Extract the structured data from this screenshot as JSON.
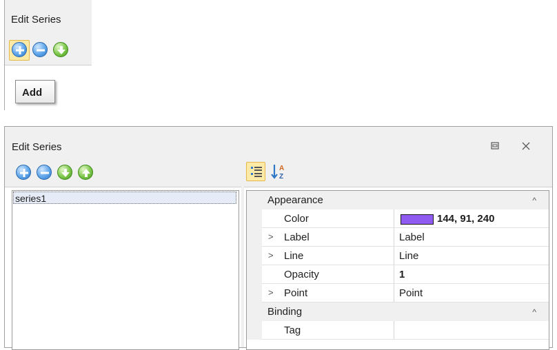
{
  "top_crop": {
    "title": "Edit Series",
    "tooltip": "Add"
  },
  "dialog": {
    "title": "Edit Series",
    "series": [
      "series1"
    ],
    "grid": {
      "categories": [
        {
          "name": "Appearance"
        },
        {
          "name": "Binding"
        }
      ],
      "appearance": {
        "color": {
          "label": "Color",
          "value": "144, 91, 240",
          "swatch": "#905bf0"
        },
        "label": {
          "label": "Label",
          "value": "Label"
        },
        "line": {
          "label": "Line",
          "value": "Line"
        },
        "opacity": {
          "label": "Opacity",
          "value": "1"
        },
        "point": {
          "label": "Point",
          "value": "Point"
        }
      },
      "binding": {
        "tag": {
          "label": "Tag",
          "value": ""
        }
      }
    }
  },
  "icons": {
    "add": "add-circle-icon",
    "remove": "remove-circle-icon",
    "down": "move-down-icon",
    "up": "move-up-icon",
    "categorized": "categorized-view-icon",
    "alphabetical": "sort-az-icon",
    "restore": "restore-window-icon",
    "close": "close-icon"
  },
  "colors": {
    "accent_blue": "#2f78c8",
    "accent_green": "#4a9a22",
    "highlight": "#fdeaa7"
  }
}
